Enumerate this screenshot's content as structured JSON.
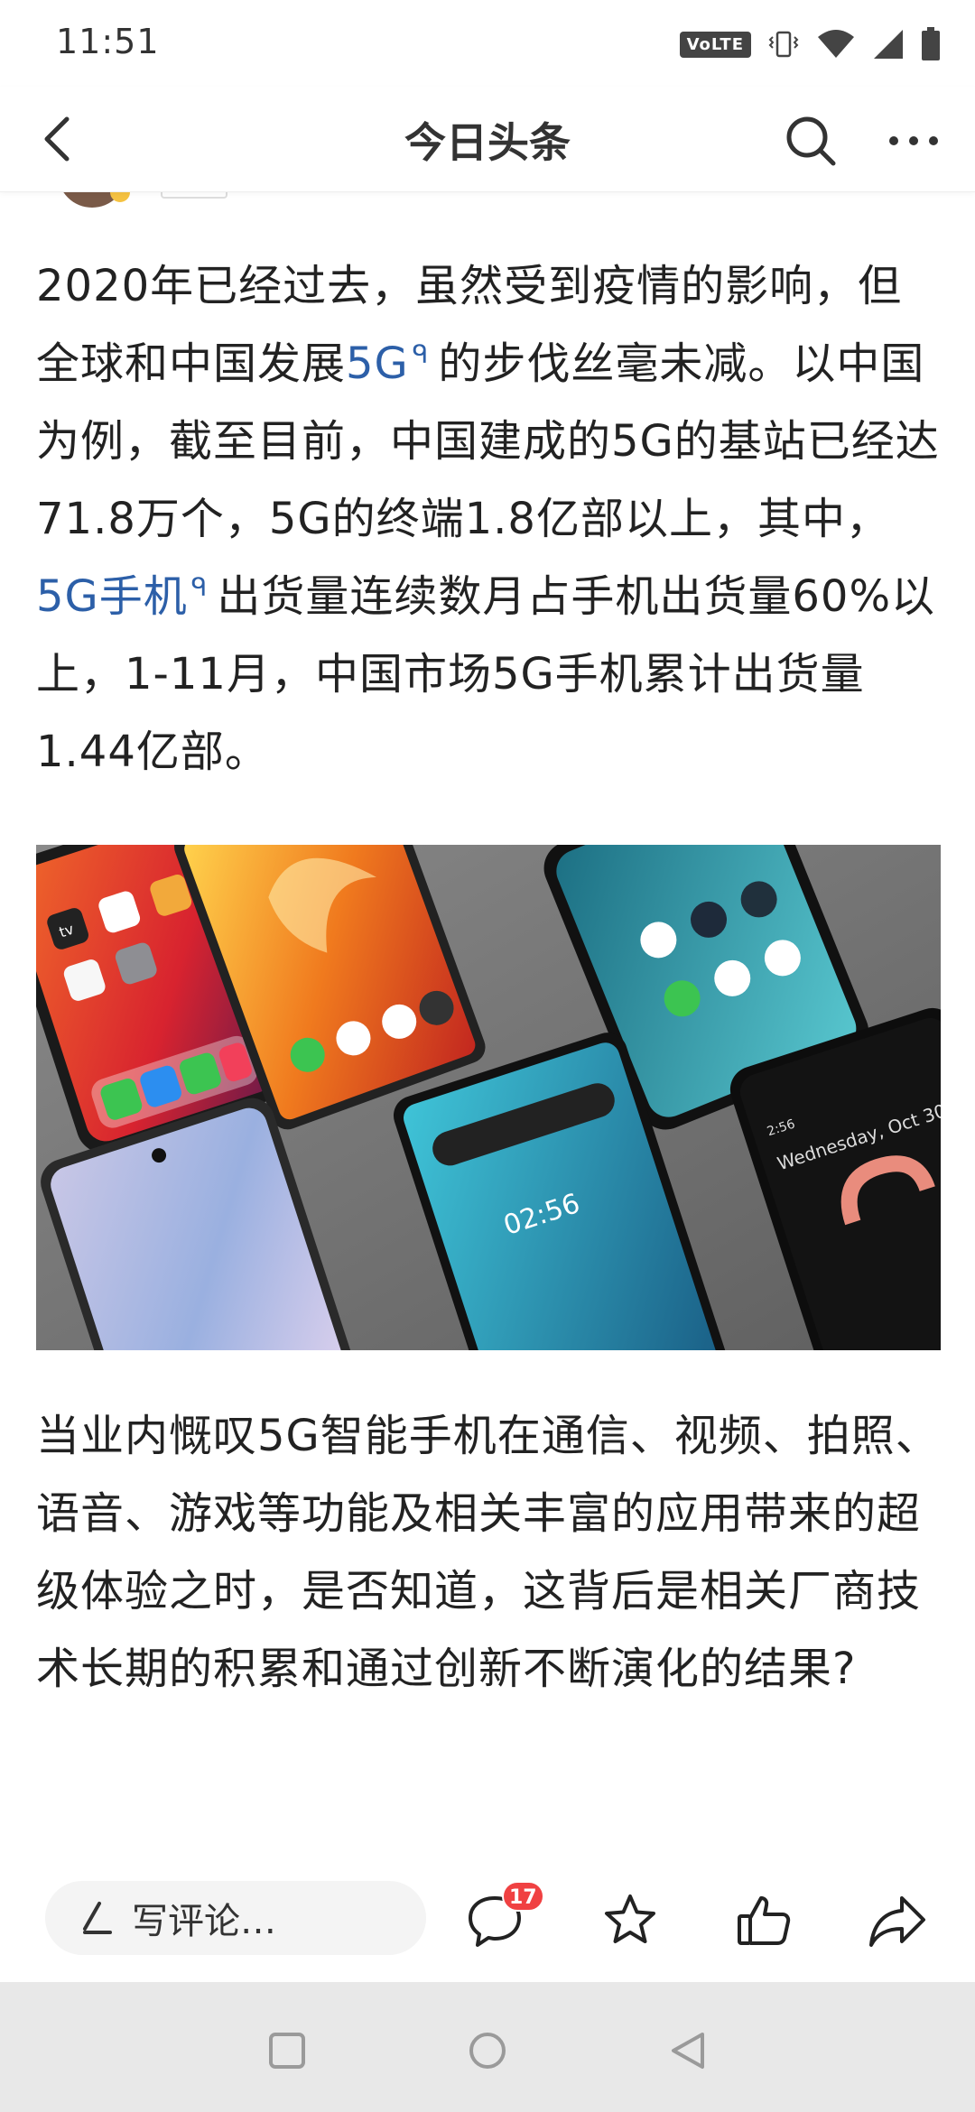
{
  "status_bar": {
    "time": "11:51",
    "volte": "VoLTE",
    "icons": [
      "volte-icon",
      "vibrate-icon",
      "wifi-icon",
      "signal-icon",
      "battery-icon"
    ]
  },
  "header": {
    "title": "今日头条",
    "icons": [
      "back-arrow-icon",
      "search-icon",
      "more-dots-icon"
    ]
  },
  "article": {
    "paragraph1": {
      "seg1": "2020年已经过去，虽然受到疫情的影响，但全球和中国发展",
      "link1": "5G",
      "seg2": "的步伐丝毫未减。以中国为例，截至目前，中国建成的5G的基站已经达71.8万个，5G的终端1.8亿部以上，其中，",
      "link2": "5G手机",
      "seg3": "出货量连续数月占手机出货量60%以上，1-11月，中国市场5G手机累计出货量1.44亿部。"
    },
    "link_icon": "ᑫ",
    "image": {
      "subject": "smartphones-grid",
      "phone_text": {
        "tv": "tv",
        "date": "Wednesday, Oct 30",
        "time": "02:56",
        "clock": "2:56"
      }
    },
    "paragraph2": "当业内慨叹5G智能手机在通信、视频、拍照、语音、游戏等功能及相关丰富的应用带来的超级体验之时，是否知道，这背后是相关厂商技术长期的积累和通过创新不断演化的结果?"
  },
  "action_bar": {
    "comment_placeholder": "写评论…",
    "comment_count": "17",
    "icons": [
      "pen-icon",
      "comment-icon",
      "star-icon",
      "thumbs-up-icon",
      "share-icon"
    ]
  },
  "nav_bar": {
    "icons": [
      "recent-apps-icon",
      "home-icon",
      "back-triangle-icon"
    ]
  },
  "colors": {
    "link": "#2c5fa8",
    "badge": "#f04142",
    "nav_bg": "#e8e8e8"
  }
}
